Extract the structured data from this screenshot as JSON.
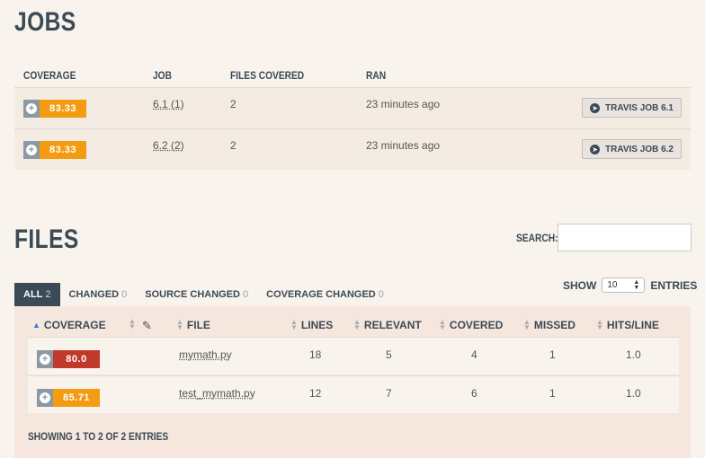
{
  "jobs": {
    "title": "JOBS",
    "headers": {
      "coverage": "COVERAGE",
      "job": "JOB",
      "files_covered": "FILES COVERED",
      "ran": "RAN"
    },
    "rows": [
      {
        "coverage": "83.33",
        "job": "6.1 (1)",
        "files_covered": "2",
        "ran": "23 minutes ago",
        "button": "TRAVIS JOB 6.1"
      },
      {
        "coverage": "83.33",
        "job": "6.2 (2)",
        "files_covered": "2",
        "ran": "23 minutes ago",
        "button": "TRAVIS JOB 6.2"
      }
    ]
  },
  "files": {
    "title": "FILES",
    "search_label": "SEARCH:",
    "search_value": "",
    "tabs": [
      {
        "label": "ALL",
        "count": "2",
        "active": true
      },
      {
        "label": "CHANGED",
        "count": "0"
      },
      {
        "label": "SOURCE CHANGED",
        "count": "0"
      },
      {
        "label": "COVERAGE CHANGED",
        "count": "0"
      }
    ],
    "show_label": "SHOW",
    "show_value": "10",
    "entries_label": "ENTRIES",
    "headers": {
      "coverage": "COVERAGE",
      "file": "FILE",
      "lines": "LINES",
      "relevant": "RELEVANT",
      "covered": "COVERED",
      "missed": "MISSED",
      "hits": "HITS/LINE"
    },
    "rows": [
      {
        "coverage": "80.0",
        "file": "mymath.py",
        "lines": "18",
        "relevant": "5",
        "covered": "4",
        "missed": "1",
        "hits": "1.0"
      },
      {
        "coverage": "85.71",
        "file": "test_mymath.py",
        "lines": "12",
        "relevant": "7",
        "covered": "6",
        "missed": "1",
        "hits": "1.0"
      }
    ],
    "showing": "SHOWING 1 TO 2 OF 2 ENTRIES"
  },
  "colors": {
    "orange_badge": "#f39c12",
    "red_badge": "#c0392b",
    "heading": "#3b4a55"
  },
  "icons": {
    "expand": "plus-circle-icon",
    "travis": "arrow-circle-right-icon",
    "edit": "pencil-icon"
  }
}
